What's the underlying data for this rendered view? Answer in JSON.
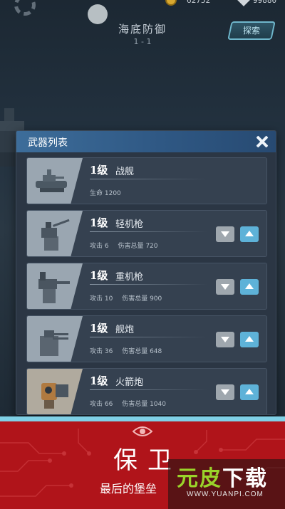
{
  "hud": {
    "coins": "62752",
    "gems": "99880"
  },
  "stage": {
    "title": "海底防御",
    "subtitle": "1 - 1",
    "explore_label": "探索"
  },
  "weapon_panel": {
    "title": "武器列表",
    "weapons": [
      {
        "level": "1级",
        "name": "战舰",
        "stat1": "生命 1200",
        "stat2": "",
        "has_controls": false,
        "icon": "battleship-icon"
      },
      {
        "level": "1级",
        "name": "轻机枪",
        "stat1": "攻击 6",
        "stat2": "伤害总量 720",
        "has_controls": true,
        "icon": "light-machine-gun-icon"
      },
      {
        "level": "1级",
        "name": "重机枪",
        "stat1": "攻击 10",
        "stat2": "伤害总量 900",
        "has_controls": true,
        "icon": "heavy-machine-gun-icon"
      },
      {
        "level": "1级",
        "name": "舰炮",
        "stat1": "攻击 36",
        "stat2": "伤害总量 648",
        "has_controls": true,
        "icon": "naval-cannon-icon"
      },
      {
        "level": "1级",
        "name": "火箭炮",
        "stat1": "攻击 66",
        "stat2": "伤害总量 1040",
        "has_controls": true,
        "icon": "rocket-launcher-icon"
      }
    ]
  },
  "banner": {
    "headline": "保卫",
    "tagline": "最后的堡垒",
    "color": "#b0141a",
    "icon": "eye-icon"
  },
  "watermark": {
    "green": "元皮",
    "white": "下载",
    "url": "WWW.YUANPI.COM"
  },
  "colors": {
    "panel_header": "#3d6d9a",
    "upgrade_button": "#5eb2d8",
    "downgrade_button": "#9fa7ae"
  }
}
